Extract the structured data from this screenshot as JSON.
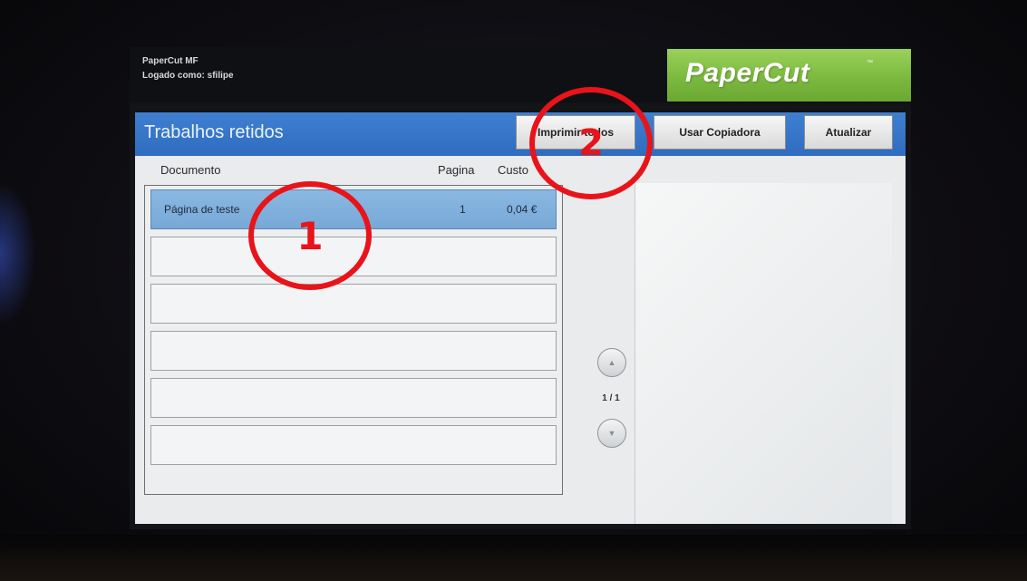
{
  "device": {
    "app_name": "PaperCut MF",
    "logged_in_as": "Logado como: sfilipe",
    "logo_text": "PaperCut",
    "logo_mark": "™",
    "brand_color": "#7cb93f",
    "accent_color": "#3576c8"
  },
  "titlebar": {
    "title": "Trabalhos retidos",
    "buttons": {
      "print_all": "Imprimir todos",
      "use_copier": "Usar Copiadora",
      "refresh": "Atualizar"
    }
  },
  "jobs": {
    "columns": {
      "document": "Documento",
      "pages": "Pagina",
      "cost": "Custo"
    },
    "rows": [
      {
        "document": "Página de teste",
        "pages": "1",
        "cost": "0,04 €"
      }
    ],
    "pager": {
      "indicator": "1 / 1",
      "up_icon": "arrow-up-icon",
      "down_icon": "arrow-down-icon"
    }
  },
  "annotations": {
    "marker_1": "1",
    "marker_2": "2",
    "marker_color": "#e8141a"
  }
}
